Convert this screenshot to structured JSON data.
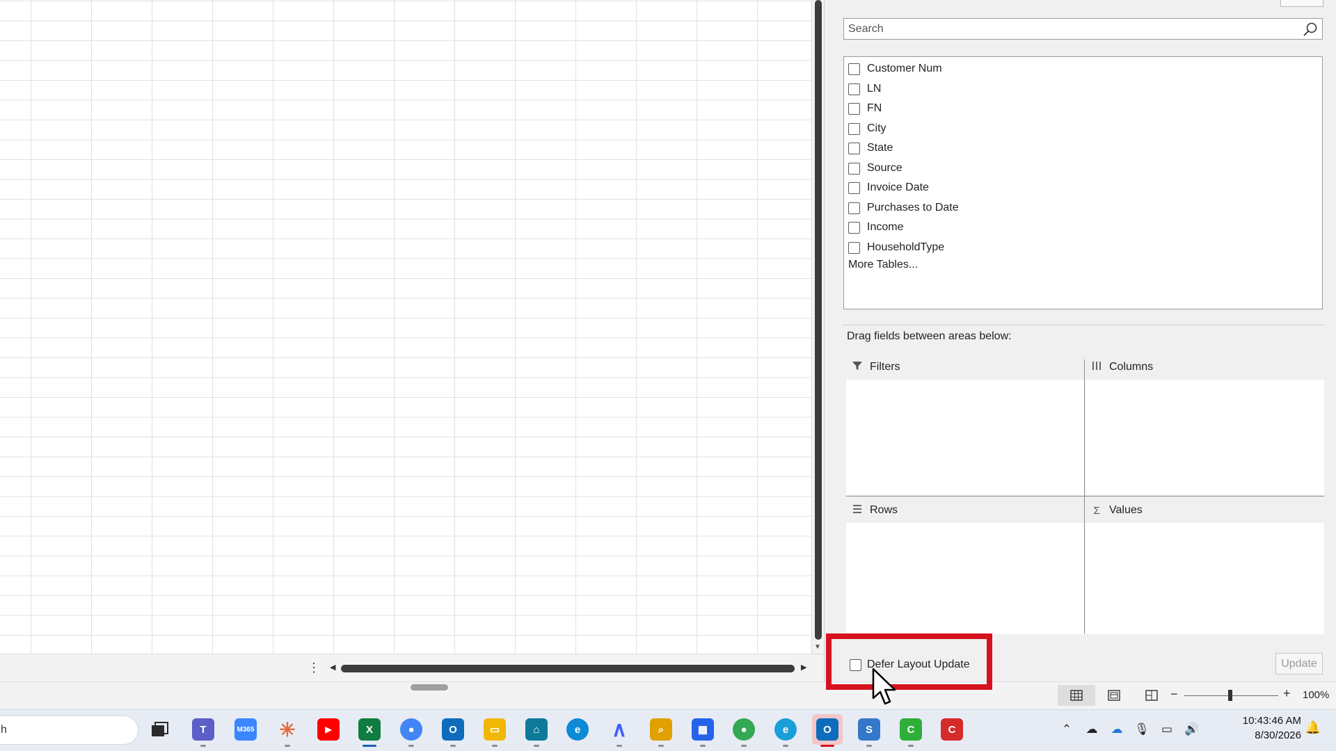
{
  "pivot_panel": {
    "search": {
      "placeholder": "Search",
      "value": ""
    },
    "fields": [
      {
        "label": "Customer Num",
        "checked": false
      },
      {
        "label": "LN",
        "checked": false
      },
      {
        "label": "FN",
        "checked": false
      },
      {
        "label": "City",
        "checked": false
      },
      {
        "label": "State",
        "checked": false
      },
      {
        "label": "Source",
        "checked": false
      },
      {
        "label": "Invoice Date",
        "checked": false
      },
      {
        "label": "Purchases to Date",
        "checked": false
      },
      {
        "label": "Income",
        "checked": false
      },
      {
        "label": "HouseholdType",
        "checked": false
      }
    ],
    "more_tables": "More Tables...",
    "drag_label": "Drag fields between areas below:",
    "areas": {
      "filters": "Filters",
      "columns": "Columns",
      "rows": "Rows",
      "values": "Values"
    },
    "defer_layout_update": {
      "label": "Defer Layout Update",
      "checked": false
    },
    "update_button": "Update"
  },
  "statusbar": {
    "zoom": "100%",
    "view_buttons": [
      "normal-view",
      "page-layout-view",
      "page-break-preview"
    ]
  },
  "taskbar": {
    "search_text": "h",
    "clock": {
      "time": "10:43:46 AM",
      "date": "8/30/2026"
    },
    "apps": [
      {
        "name": "task-view",
        "color": "#2b2b2b"
      },
      {
        "name": "teams",
        "color": "#5b5fc7"
      },
      {
        "name": "m365",
        "color": "#3a86ff",
        "text": "M365"
      },
      {
        "name": "claude",
        "color": "#e46a3d"
      },
      {
        "name": "youtube",
        "color": "#ff0000"
      },
      {
        "name": "excel",
        "color": "#107c41",
        "text": "X"
      },
      {
        "name": "chrome-profile",
        "color": "#4285f4"
      },
      {
        "name": "outlook-mail",
        "color": "#0f6cbd"
      },
      {
        "name": "file-explorer",
        "color": "#f2b705"
      },
      {
        "name": "network-app",
        "color": "#0e7a9b"
      },
      {
        "name": "edge",
        "color": "#0c8ad6"
      },
      {
        "name": "nord",
        "color": "#3e5fff"
      },
      {
        "name": "search-docs",
        "color": "#e0a100"
      },
      {
        "name": "calendar-app",
        "color": "#2563eb"
      },
      {
        "name": "chrome-alt",
        "color": "#34a853"
      },
      {
        "name": "edge-alt",
        "color": "#1b9fd9"
      },
      {
        "name": "outlook",
        "color": "#0f6cbd"
      },
      {
        "name": "snagit-s",
        "color": "#3577c9",
        "text": "S"
      },
      {
        "name": "camtasia-green",
        "color": "#2fae3a"
      },
      {
        "name": "camtasia-red",
        "color": "#d62b2b"
      }
    ]
  },
  "colors": {
    "highlight": "#d5121d",
    "panel_bg": "#f0f0f0"
  }
}
